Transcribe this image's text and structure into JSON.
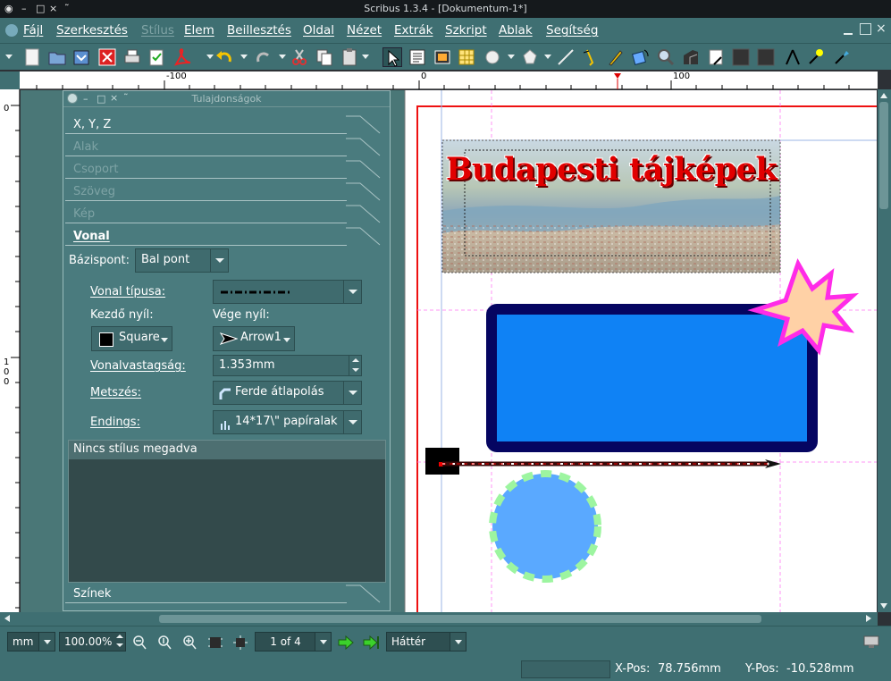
{
  "window": {
    "title": "Scribus 1.3.4 - [Dokumentum-1*]"
  },
  "menu": {
    "items": [
      "Fájl",
      "Szerkesztés",
      "Stílus",
      "Elem",
      "Beillesztés",
      "Oldal",
      "Nézet",
      "Extrák",
      "Szkript",
      "Ablak",
      "Segítség"
    ],
    "disabled_item": "Stílus"
  },
  "ruler": {
    "h_labels": [
      "-100",
      "0",
      "100"
    ],
    "v_labels": [
      "0",
      "1",
      "0",
      "0"
    ]
  },
  "panel": {
    "title": "Tulajdonságok",
    "sections": {
      "xyz": "X, Y, Z",
      "shape": "Alak",
      "group": "Csoport",
      "text": "Szöveg",
      "image": "Kép",
      "line": "Vonal",
      "colors": "Színek"
    },
    "basepoint_label": "Bázispont:",
    "basepoint_value": "Bal pont",
    "line_type_label": "Vonal típusa:",
    "start_arrow_label": "Kezdő nyíl:",
    "end_arrow_label": "Vége nyíl:",
    "start_arrow_value": "Square",
    "end_arrow_value": "Arrow1",
    "linewidth_label": "Vonalvastagság:",
    "linewidth_value": "1.353mm",
    "join_label": "Metszés:",
    "join_value": "Ferde átlapolás",
    "endings_label": "Endings:",
    "endings_value": "14*17\\\" papíralak",
    "style_header": "Nincs stílus megadva"
  },
  "document": {
    "headline": "Budapesti tájképek"
  },
  "status": {
    "unit": "mm",
    "zoom": "100.00%",
    "page": "1 of 4",
    "layer": "Háttér",
    "xpos_label": "X-Pos:",
    "xpos_value": "78.756mm",
    "ypos_label": "Y-Pos:",
    "ypos_value": "-10.528mm"
  },
  "colors": {
    "menubar": "#3f6f72",
    "panel": "#4a7b7e",
    "canvas": "#4a7777",
    "rect_fill": "#0f82f5",
    "rect_stroke": "#050561",
    "circle_fill": "#5aa9ff",
    "circle_stroke": "#9df5a0",
    "star_fill": "#ffd1a6",
    "star_stroke": "#ff2be8",
    "headline": "#e10000",
    "page_margin": "#ff0000"
  }
}
